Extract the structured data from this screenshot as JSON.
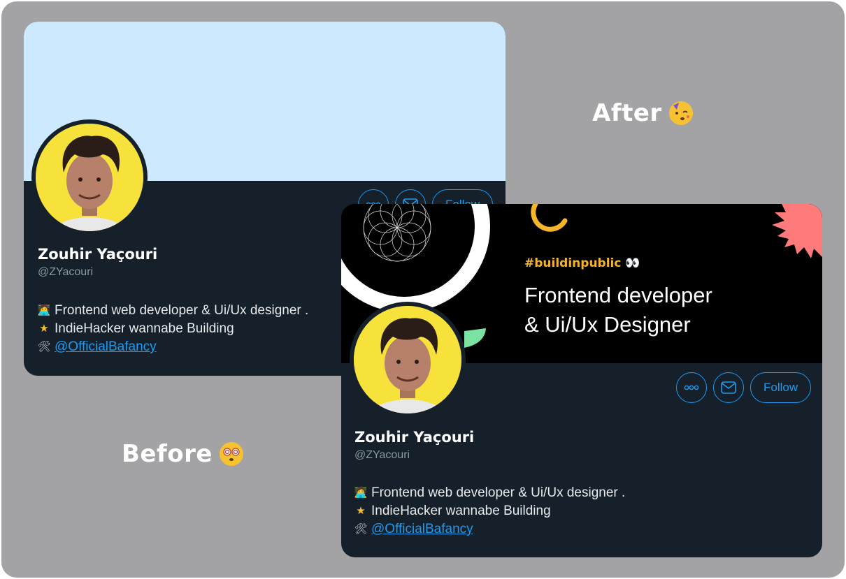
{
  "captions": {
    "after": "After",
    "before": "Before"
  },
  "before_card": {
    "name": "Zouhir Yaçouri",
    "handle": "@ZYacouri",
    "follow_label": "Follow",
    "bio": [
      "Frontend web developer & Ui/Ux designer .",
      "IndieHacker wannabe Building",
      "@OfficialBafancy"
    ]
  },
  "after_card": {
    "hashtag": "#buildinpublic",
    "headline_line1": "Frontend developer",
    "headline_line2": "& Ui/Ux Designer",
    "name": "Zouhir Yaçouri",
    "handle": "@ZYacouri",
    "follow_label": "Follow",
    "bio": [
      "Frontend web developer & Ui/Ux designer .",
      "IndieHacker wannabe Building",
      "@OfficialBafancy"
    ]
  },
  "icons": {
    "more": "more-icon",
    "mail": "mail-icon",
    "laptop": "technologist-icon",
    "star": "star-icon",
    "tools": "hammer-wrench-icon",
    "eyes": "eyes-icon",
    "party": "partying-face-icon",
    "dizzy": "dizzy-face-icon"
  },
  "colors": {
    "background": "#a3a3a5",
    "card": "#15202b",
    "before_banner": "#cce9fd",
    "after_banner": "#000000",
    "accent_blue": "#1d9bf0",
    "hashtag_yellow": "#f5b52a",
    "avatar_yellow": "#f6e23a"
  }
}
